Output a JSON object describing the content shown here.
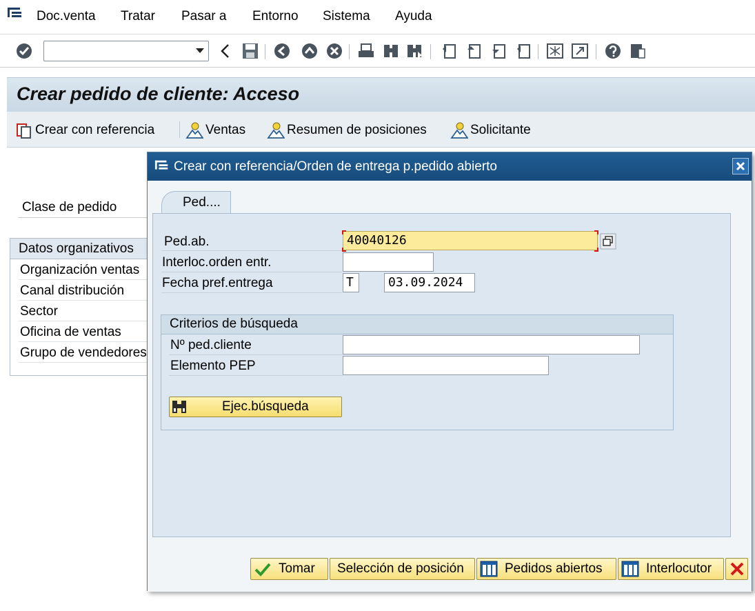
{
  "menu": {
    "items": [
      {
        "label": "Doc.venta"
      },
      {
        "label": "Tratar"
      },
      {
        "label": "Pasar a"
      },
      {
        "label": "Entorno"
      },
      {
        "label": "Sistema"
      },
      {
        "label": "Ayuda"
      }
    ]
  },
  "toolbar": {
    "command_field": {
      "value": "",
      "placeholder": ""
    },
    "icons": [
      "check-icon",
      "back-arrow-icon",
      "save-icon",
      "back-icon",
      "exit-icon",
      "cancel-icon",
      "print-icon",
      "find-icon",
      "find-next-icon",
      "first-page-icon",
      "previous-page-icon",
      "next-page-icon",
      "last-page-icon",
      "new-session-icon",
      "shortcut-icon",
      "help-icon",
      "layout-menu-icon"
    ]
  },
  "screen": {
    "title": "Crear pedido de cliente: Acceso",
    "app_toolbar": {
      "crear_con_referencia": "Crear con referencia",
      "ventas": "Ventas",
      "resumen_posiciones": "Resumen de posiciones",
      "solicitante": "Solicitante"
    },
    "clase_pedido_label": "Clase de pedido",
    "org_box": {
      "header": "Datos organizativos",
      "rows": [
        "Organización ventas",
        "Canal distribución",
        "Sector",
        "Oficina de ventas",
        "Grupo de vendedores"
      ]
    }
  },
  "dialog": {
    "title": "Crear con referencia/Orden de entrega p.pedido abierto",
    "tab_label": "Ped....",
    "fields": {
      "ped_ab": {
        "label": "Ped.ab.",
        "value": "40040126"
      },
      "interloc": {
        "label": "Interloc.orden entr.",
        "value": ""
      },
      "fecha": {
        "label": "Fecha pref.entrega",
        "type_value": "T",
        "date_value": "03.09.2024"
      }
    },
    "criterios": {
      "title": "Criterios de búsqueda",
      "n_ped_cliente": {
        "label": "Nº ped.cliente",
        "value": ""
      },
      "elemento_pep": {
        "label": "Elemento PEP",
        "value": ""
      },
      "search_button": "Ejec.búsqueda"
    },
    "footer": {
      "tomar": "Tomar",
      "seleccion": "Selección de posición",
      "pedidos_abiertos": "Pedidos abiertos",
      "interlocutor": "Interlocutor"
    }
  },
  "colors": {
    "dialog_title_bg": "#1f5d93",
    "required_field_bg": "#fbeb9b",
    "button_bg": "#f7e07c",
    "panel_bg": "#dce7f1"
  }
}
